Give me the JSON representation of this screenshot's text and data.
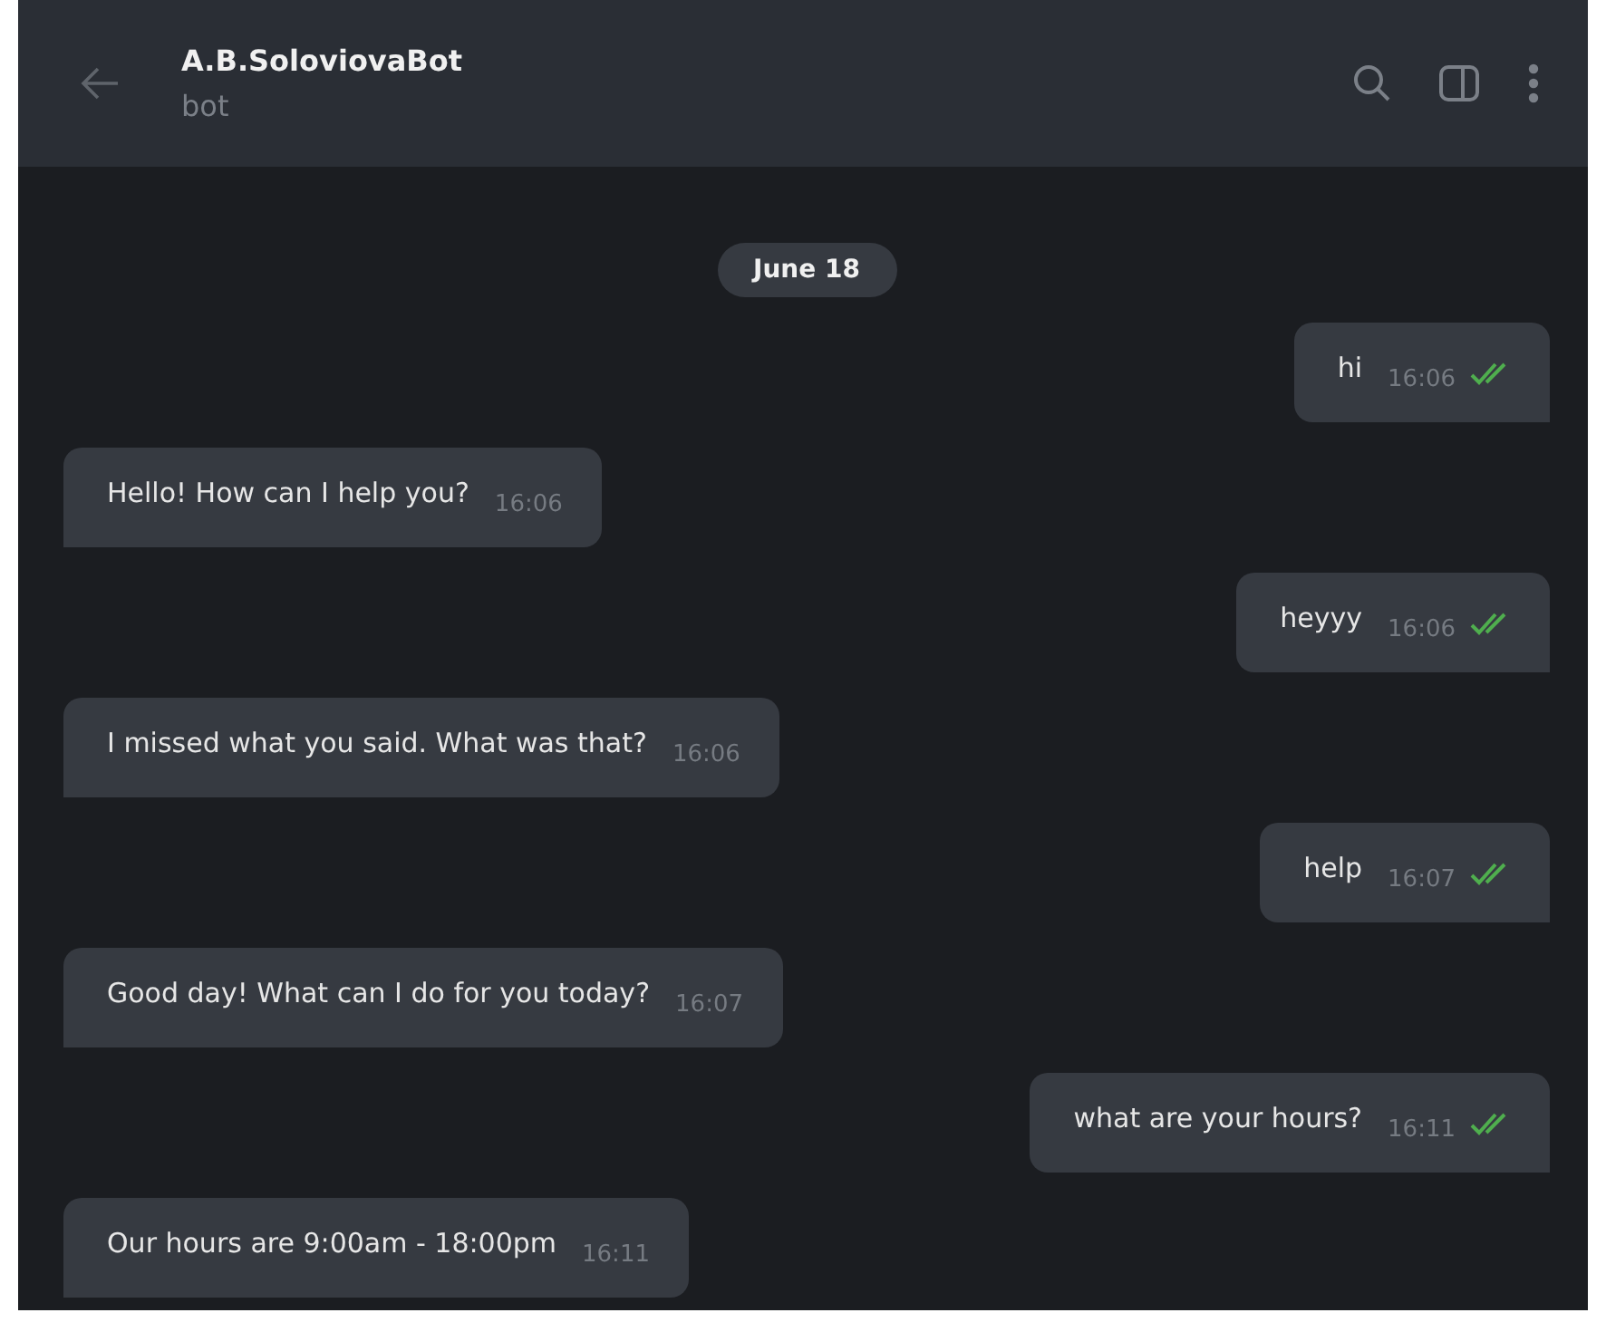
{
  "header": {
    "title": "A.B.SoloviovaBot",
    "subtitle": "bot"
  },
  "date": "June 18",
  "messages": [
    {
      "kind": "out",
      "text": "hi",
      "time": "16:06",
      "read": true
    },
    {
      "kind": "in",
      "text": "Hello! How can I help you?",
      "time": "16:06"
    },
    {
      "kind": "out",
      "text": "heyyy",
      "time": "16:06",
      "read": true
    },
    {
      "kind": "in",
      "text": "I missed what you said. What was that?",
      "time": "16:06"
    },
    {
      "kind": "out",
      "text": "help",
      "time": "16:07",
      "read": true
    },
    {
      "kind": "in",
      "text": "Good day! What can I do for you today?",
      "time": "16:07"
    },
    {
      "kind": "out",
      "text": "what are your hours?",
      "time": "16:11",
      "read": true
    },
    {
      "kind": "in",
      "text": "Our hours are 9:00am - 18:00pm",
      "time": "16:11"
    }
  ]
}
